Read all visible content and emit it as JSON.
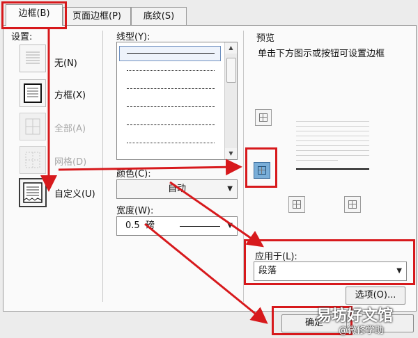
{
  "tabs": [
    {
      "label": "边框(B)",
      "active": true
    },
    {
      "label": "页面边框(P)",
      "active": false
    },
    {
      "label": "底纹(S)",
      "active": false
    }
  ],
  "settings": {
    "title": "设置:",
    "items": [
      {
        "label": "无(N)",
        "enabled": true
      },
      {
        "label": "方框(X)",
        "enabled": true
      },
      {
        "label": "全部(A)",
        "enabled": false
      },
      {
        "label": "网格(D)",
        "enabled": false
      },
      {
        "label": "自定义(U)",
        "enabled": true,
        "selected": true
      }
    ]
  },
  "line_style": {
    "label": "线型(Y):"
  },
  "color": {
    "label": "颜色(C):",
    "value": "自动"
  },
  "width": {
    "label": "宽度(W):",
    "value": "0.5  磅"
  },
  "preview": {
    "title": "预览",
    "hint": "单击下方图示或按钮可设置边框"
  },
  "apply_to": {
    "label": "应用于(L):",
    "value": "段落"
  },
  "buttons": {
    "options": "选项(O)...",
    "ok": "确定"
  },
  "watermark": {
    "line1": "易坊好文馆",
    "line2": "@微修学助"
  },
  "colors": {
    "annotation_red": "#d7191c",
    "selected_blue": "#7aaed8"
  }
}
